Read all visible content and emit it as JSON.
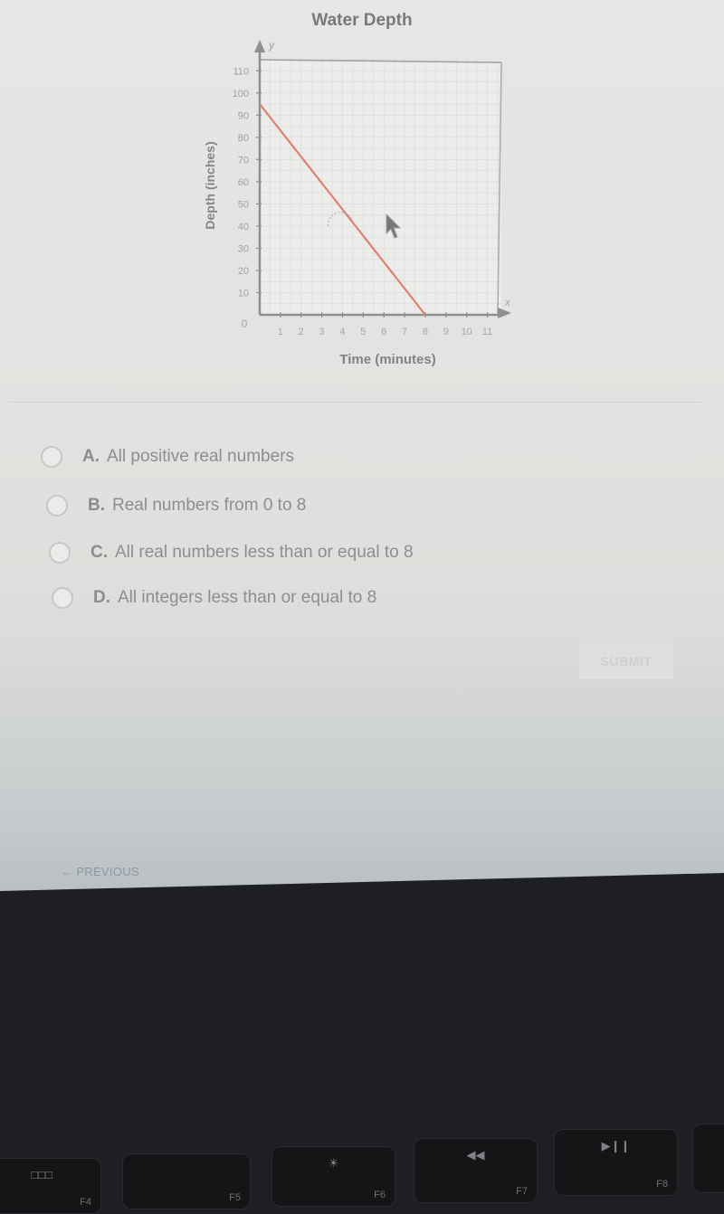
{
  "chart_data": {
    "type": "line",
    "title": "Water Depth",
    "xlabel": "Time (minutes)",
    "ylabel": "Depth (inches)",
    "x_axis_letter": "x",
    "y_axis_letter": "y",
    "origin_label": "0",
    "xlim": [
      0,
      11.5
    ],
    "ylim": [
      0,
      115
    ],
    "x_ticks": [
      1,
      2,
      3,
      4,
      5,
      6,
      7,
      8,
      9,
      10,
      11
    ],
    "y_ticks": [
      10,
      20,
      30,
      40,
      50,
      60,
      70,
      80,
      90,
      100,
      110
    ],
    "grid": true,
    "series": [
      {
        "name": "Water Depth",
        "color": "#e07f72",
        "x": [
          0,
          8
        ],
        "y": [
          95,
          0
        ]
      }
    ]
  },
  "question": {
    "options": [
      {
        "letter": "A.",
        "text": "All positive real numbers"
      },
      {
        "letter": "B.",
        "text": "Real numbers from 0 to 8"
      },
      {
        "letter": "C.",
        "text": "All real numbers less than or equal to 8"
      },
      {
        "letter": "D.",
        "text": "All integers less than or equal to 8"
      }
    ]
  },
  "buttons": {
    "submit": "SUBMIT",
    "previous": "PREVIOUS",
    "previous_icon": "←"
  },
  "keyboard": {
    "keys": [
      {
        "label": "F4",
        "glyph": "□□□"
      },
      {
        "label": "F5",
        "glyph": ""
      },
      {
        "label": "F6",
        "glyph": "☀"
      },
      {
        "label": "F7",
        "glyph": "◀◀"
      },
      {
        "label": "F8",
        "glyph": "▶❙❙"
      }
    ]
  },
  "colors": {
    "line": "#e07f72",
    "axis": "#8d8f91",
    "grid": "#dcdcdc"
  }
}
